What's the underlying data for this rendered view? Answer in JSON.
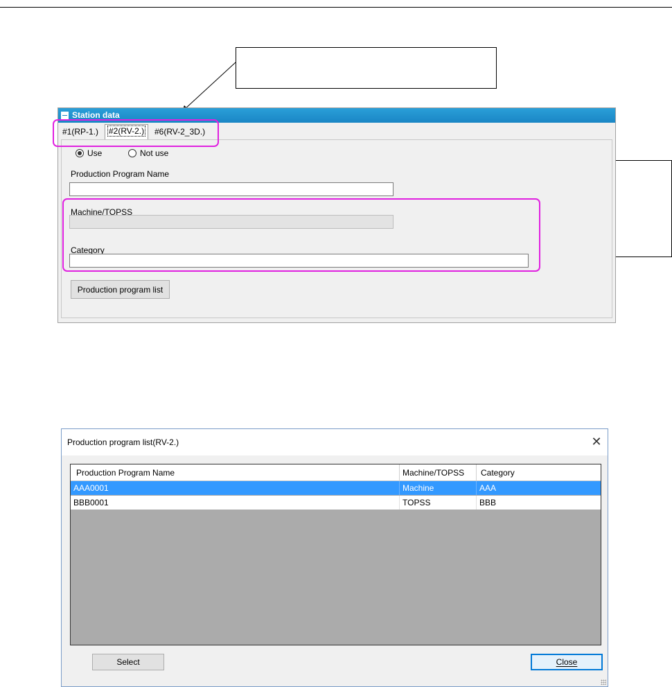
{
  "station_panel": {
    "title": "Station data",
    "tabs": [
      {
        "label": "#1(RP-1.)",
        "active": false
      },
      {
        "label": "#2(RV-2.)",
        "active": true
      },
      {
        "label": "#6(RV-2_3D.)",
        "active": false
      }
    ],
    "use_option": {
      "selected": "Use",
      "options": [
        "Use",
        "Not use"
      ]
    },
    "production_program_name": {
      "label": "Production Program Name",
      "value": ""
    },
    "machine_topss": {
      "label": "Machine/TOPSS",
      "value": ""
    },
    "category": {
      "label": "Category",
      "value": ""
    },
    "list_button": "Production program list"
  },
  "dialog": {
    "title": "Production program list(RV-2.)",
    "close_glyph": "✕",
    "columns": [
      "Production Program Name",
      "Machine/TOPSS",
      "Category"
    ],
    "rows": [
      {
        "name": "AAA0001",
        "type": "Machine",
        "category": "AAA",
        "selected": true
      },
      {
        "name": "BBB0001",
        "type": "TOPSS",
        "category": "BBB",
        "selected": false
      }
    ],
    "select_button": "Select",
    "close_button": "Close"
  },
  "colors": {
    "highlight": "#e020e0",
    "header_blue": "#1a86c5",
    "selected_row": "#3399ff"
  }
}
